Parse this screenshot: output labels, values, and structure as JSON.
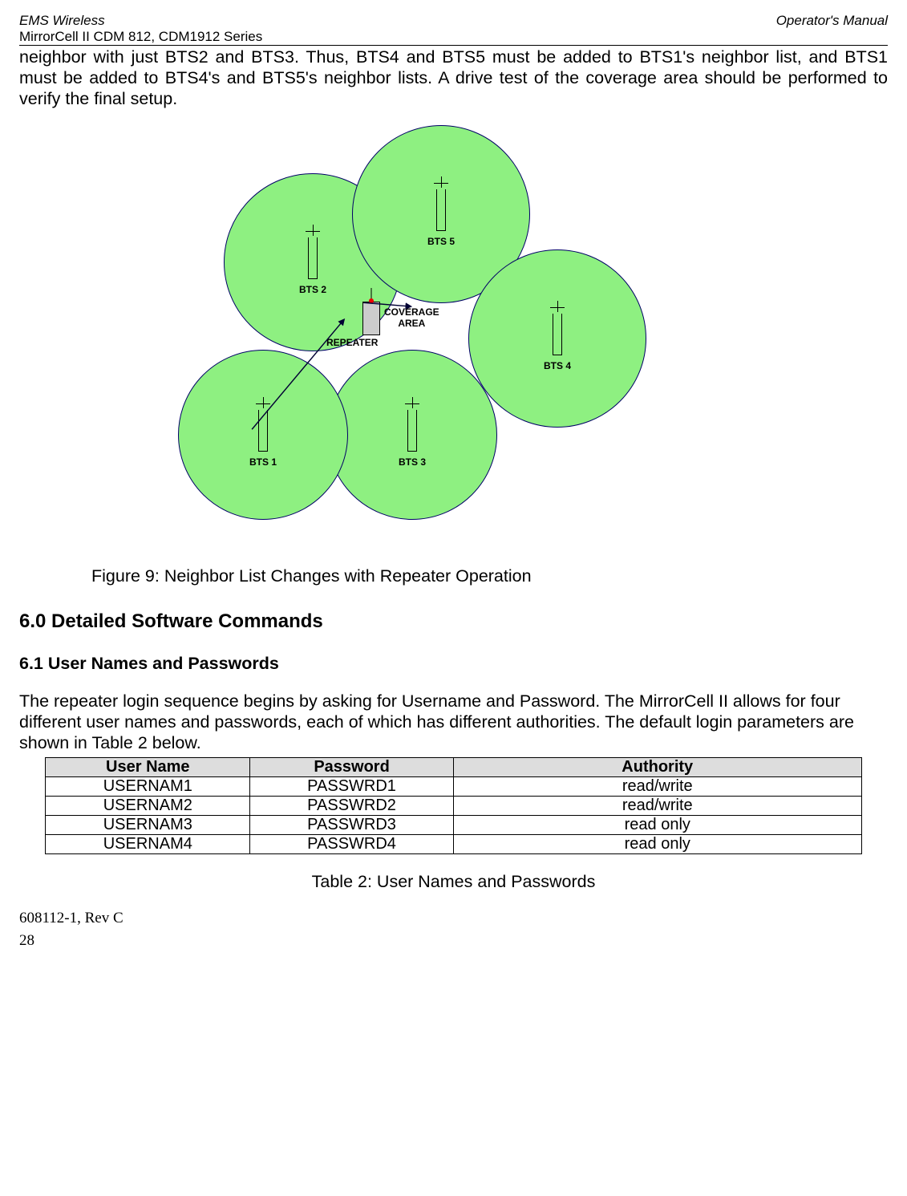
{
  "header": {
    "left_top": "EMS Wireless",
    "right_top": "Operator's Manual",
    "left_sub": "MirrorCell II CDM 812, CDM1912 Series"
  },
  "intro_paragraph": "neighbor with just BTS2 and BTS3. Thus, BTS4 and BTS5 must be added to BTS1's neighbor list, and BTS1 must be added to BTS4's and BTS5's neighbor lists. A drive test of the coverage area should be performed to verify the final setup.",
  "figure": {
    "bts1": "BTS 1",
    "bts2": "BTS 2",
    "bts3": "BTS 3",
    "bts4": "BTS 4",
    "bts5": "BTS 5",
    "repeater": "REPEATER",
    "coverage_line1": "COVERAGE",
    "coverage_line2": "AREA",
    "caption": "Figure 9:  Neighbor List Changes with Repeater Operation"
  },
  "section6": {
    "heading": "6.0  Detailed Software Commands",
    "sub61_heading": "6.1  User Names and Passwords",
    "sub61_para": "The repeater login sequence begins by asking for Username and Password. The MirrorCell II allows for four different user names and passwords, each of which has different authorities. The default login parameters are shown in Table 2 below."
  },
  "table2": {
    "headers": {
      "c1": "User Name",
      "c2": "Password",
      "c3": "Authority"
    },
    "rows": [
      {
        "user": "USERNAM1",
        "pass": "PASSWRD1",
        "auth": "read/write"
      },
      {
        "user": "USERNAM2",
        "pass": "PASSWRD2",
        "auth": "read/write"
      },
      {
        "user": "USERNAM3",
        "pass": "PASSWRD3",
        "auth": "read only"
      },
      {
        "user": "USERNAM4",
        "pass": "PASSWRD4",
        "auth": "read only"
      }
    ],
    "caption": "Table 2:  User Names and Passwords"
  },
  "footer": {
    "doc_rev": "608112-1, Rev C",
    "page": "28"
  },
  "chart_data": {
    "type": "table",
    "title": "Table 2: User Names and Passwords",
    "columns": [
      "User Name",
      "Password",
      "Authority"
    ],
    "rows": [
      [
        "USERNAM1",
        "PASSWRD1",
        "read/write"
      ],
      [
        "USERNAM2",
        "PASSWRD2",
        "read/write"
      ],
      [
        "USERNAM3",
        "PASSWRD3",
        "read only"
      ],
      [
        "USERNAM4",
        "PASSWRD4",
        "read only"
      ]
    ]
  }
}
